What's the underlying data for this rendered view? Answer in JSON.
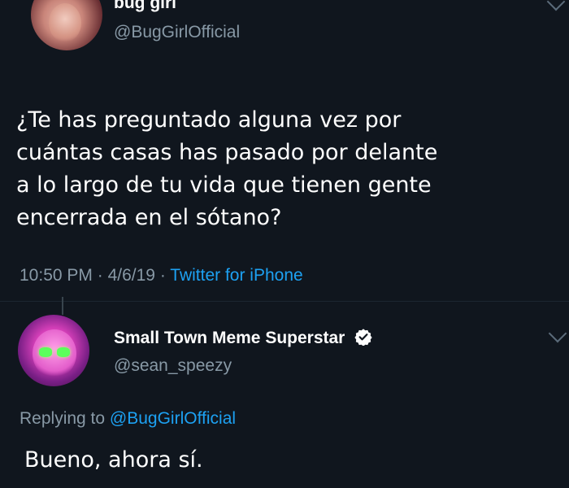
{
  "original_tweet": {
    "display_name": "bug girl",
    "handle": "@BugGirlOfficial",
    "text_lines": [
      "¿Te has preguntado alguna vez por",
      "cuántas casas has pasado por delante",
      "a lo largo de tu vida que tienen gente",
      "encerrada en el sótano?"
    ],
    "time": "10:50 PM",
    "date": "4/6/19",
    "separator": "·",
    "source": "Twitter for iPhone"
  },
  "reply_tweet": {
    "display_name": "Small Town Meme Superstar",
    "handle": "@sean_speezy",
    "verified": true,
    "replying_to_prefix": "Replying to",
    "replying_to_handle": "@BugGirlOfficial",
    "text": "Bueno, ahora sí."
  },
  "icons": {
    "verified": "verified-badge-icon",
    "more": "chevron-down-icon"
  },
  "colors": {
    "background": "#10161e",
    "text": "#ffffff",
    "secondary": "#8899a6",
    "link": "#1da1f2"
  }
}
